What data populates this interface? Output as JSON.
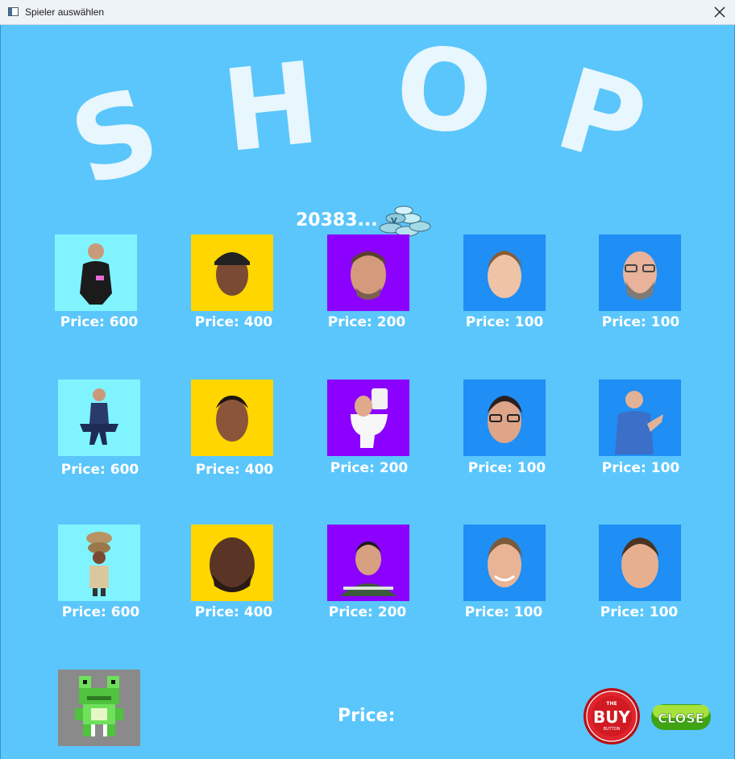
{
  "window": {
    "title": "Spieler auswählen"
  },
  "header": {
    "shop_title": "SHOP",
    "letters": [
      "S",
      "H",
      "O",
      "P"
    ],
    "coins": "20383..."
  },
  "colors": {
    "background": "#5bc6fb",
    "cyan_tile": "#7ff4fe",
    "yellow_tile": "#ffd600",
    "purple_tile": "#8b00ff",
    "blue_tile": "#1f8ef5",
    "gray_tile": "#8a8a8a"
  },
  "grid": {
    "rows": [
      [
        {
          "name": "character-person-black-hoodie",
          "price": "Price: 600",
          "tile": "cyan"
        },
        {
          "name": "character-face-cap",
          "price": "Price: 400",
          "tile": "yellow"
        },
        {
          "name": "character-face-smiling-man",
          "price": "Price: 200",
          "tile": "purple"
        },
        {
          "name": "character-face-young-man",
          "price": "Price: 100",
          "tile": "blue"
        },
        {
          "name": "character-face-bald-glasses",
          "price": "Price: 100",
          "tile": "blue"
        }
      ],
      [
        {
          "name": "character-person-sitting",
          "price": "Price: 600",
          "tile": "cyan"
        },
        {
          "name": "character-face-man",
          "price": "Price: 400",
          "tile": "yellow"
        },
        {
          "name": "character-toilet-head",
          "price": "Price: 200",
          "tile": "purple"
        },
        {
          "name": "character-face-glasses",
          "price": "Price: 100",
          "tile": "blue"
        },
        {
          "name": "character-person-doctor",
          "price": "Price: 100",
          "tile": "blue"
        }
      ],
      [
        {
          "name": "character-stacked-figure",
          "price": "Price: 600",
          "tile": "cyan"
        },
        {
          "name": "character-face-bearded",
          "price": "Price: 400",
          "tile": "yellow"
        },
        {
          "name": "character-portrait",
          "price": "Price: 200",
          "tile": "purple"
        },
        {
          "name": "character-face-smiling",
          "price": "Price: 100",
          "tile": "blue"
        },
        {
          "name": "character-face-man-2",
          "price": "Price: 100",
          "tile": "blue"
        }
      ]
    ]
  },
  "selected": {
    "name": "frog-pixel-avatar"
  },
  "footer": {
    "price_label": "Price:",
    "buy_text_top": "THE",
    "buy_text_main": "BUY",
    "buy_text_bottom": "BUTTON",
    "close_label": "CLOSE"
  }
}
